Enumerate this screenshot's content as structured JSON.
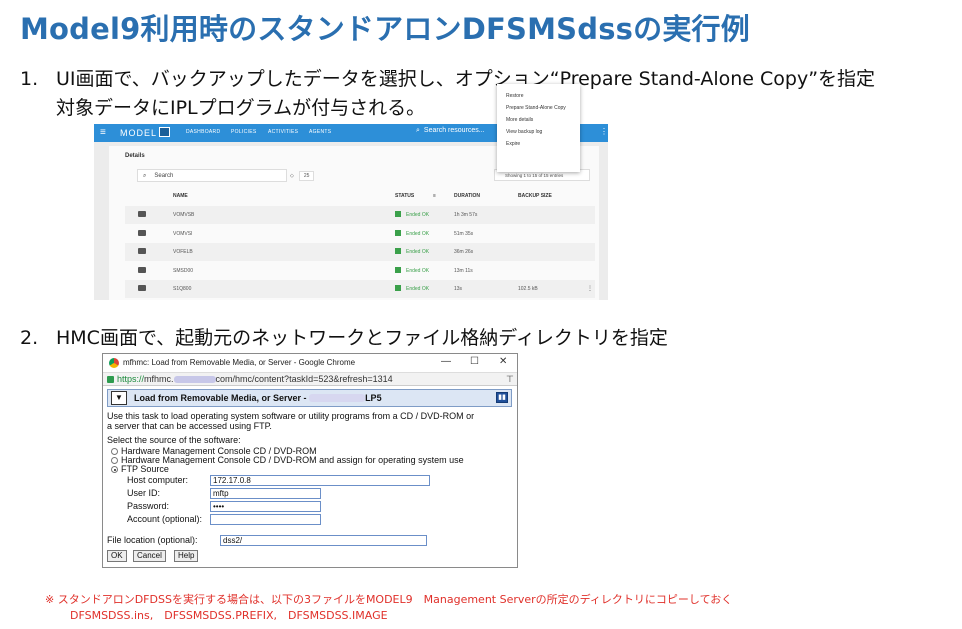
{
  "slide": {
    "title": "Model9利用時のスタンドアロンDFSMSdssの実行例",
    "step1": {
      "num": "1.",
      "line1": "UI画面で、バックアップしたデータを選択し、オプション“Prepare Stand-Alone Copy”を指定",
      "line2": "対象データにIPLプログラムが付与される。"
    },
    "step2": {
      "num": "2.",
      "line1": "HMC画面で、起動元のネットワークとファイル格納ディレクトリを指定"
    },
    "note_line1": "※ スタンドアロンDFDSSを実行する場合は、以下の3ファイルをMODEL9　Management Serverの所定のディレクトリにコピーしておく",
    "note_line2": "DFSMSDSS.ins,　DFSSMSDSS.PREFIX,　DFSMSDSS.IMAGE"
  },
  "model9": {
    "menu_glyph": "≡",
    "logo": "MODEL",
    "nav": [
      "DASHBOARD",
      "POLICIES",
      "ACTIVITIES",
      "AGENTS"
    ],
    "search_placeholder": "Search resources...",
    "search_icon": "search-icon",
    "kebab": "⋮",
    "details_title": "Details",
    "filter_placeholder": "Search",
    "per_page_value": "25",
    "showing": "Showing 1 to 15 of 15 entries",
    "columns": {
      "name": "NAME",
      "status": "STATUS",
      "duration": "DURATION",
      "size": "BACKUP SIZE"
    },
    "rows": [
      {
        "name": "VOMVSB",
        "status": "Ended OK",
        "duration": "1h 3m 57s",
        "size": ""
      },
      {
        "name": "VOMVSI",
        "status": "Ended OK",
        "duration": "51m 35s",
        "size": ""
      },
      {
        "name": "VOFELB",
        "status": "Ended OK",
        "duration": "36m 26s",
        "size": ""
      },
      {
        "name": "SMSD00",
        "status": "Ended OK",
        "duration": "13m 11s",
        "size": ""
      },
      {
        "name": "S1Q800",
        "status": "Ended OK",
        "duration": "13s",
        "size": "102.5 kB"
      }
    ],
    "row_menu_glyph": "⋮",
    "context_menu": [
      "Restore",
      "Prepare Stand-Alone Copy",
      "More details",
      "View backup log",
      "Expire"
    ]
  },
  "hmc": {
    "window_title": "mfhmc: Load from Removable Media, or Server - Google Chrome",
    "win_min": "—",
    "win_max": "☐",
    "win_close": "✕",
    "url_scheme": "https://",
    "url_host": "mfhmc.",
    "url_rest": "com/hmc/content?taskId=523&refresh=1314",
    "pin_glyph": "⊤",
    "task_icon_glyph": "▼",
    "task_title": "Load from Removable Media, or Server - ",
    "task_title_suffix": "LP5",
    "desc_line1": "Use this task to load operating system software or utility programs from a CD / DVD-ROM or",
    "desc_line2": "a server that can be accessed using FTP.",
    "select_label": "Select the source of the software:",
    "options": [
      "Hardware Management Console CD / DVD-ROM",
      "Hardware Management Console CD / DVD-ROM and assign for operating system use",
      "FTP Source"
    ],
    "fields": {
      "host_label": "Host computer:",
      "host_value": "172.17.0.8",
      "user_label": "User ID:",
      "user_value": "mftp",
      "pass_label": "Password:",
      "pass_value": "••••",
      "account_label": "Account (optional):",
      "account_value": "",
      "file_label": "File location (optional):",
      "file_value": "dss2/"
    },
    "buttons": {
      "ok": "OK",
      "cancel": "Cancel",
      "help": "Help"
    }
  }
}
